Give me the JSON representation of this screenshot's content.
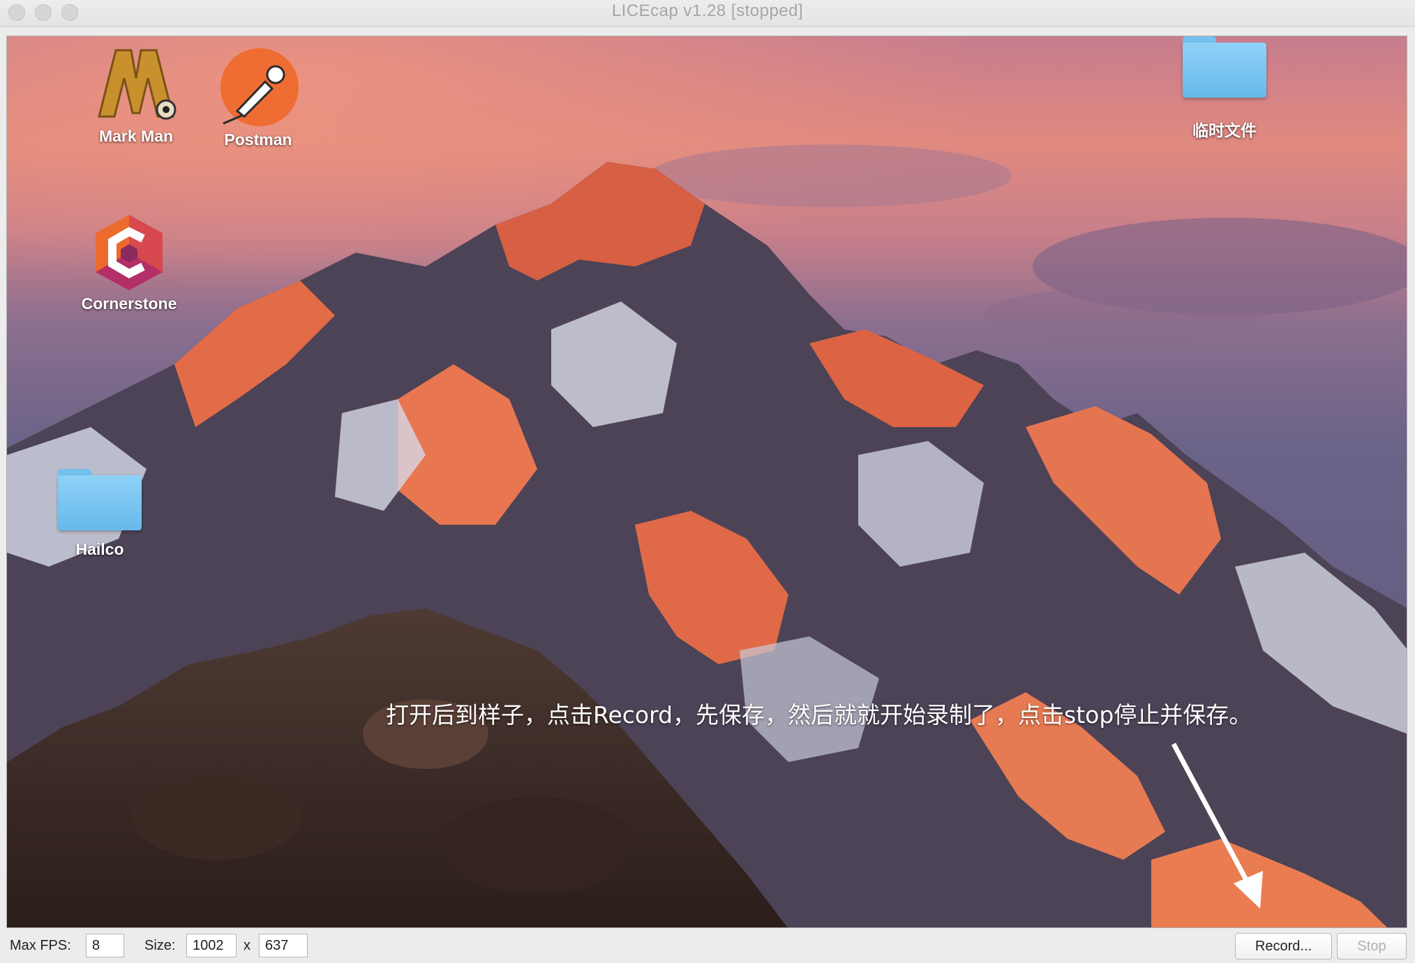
{
  "window": {
    "title": "LICEcap v1.28 [stopped]"
  },
  "desktop": {
    "icons": [
      {
        "label": "Mark Man"
      },
      {
        "label": "Postman"
      },
      {
        "label": "Cornerstone"
      },
      {
        "label": "Hailco"
      },
      {
        "label": "临时文件"
      }
    ],
    "annotation": "打开后到样子，点击Record，先保存，然后就就开始录制了，点击stop停止并保存。"
  },
  "controls": {
    "max_fps_label": "Max FPS:",
    "max_fps_value": "8",
    "size_label": "Size:",
    "width_value": "1002",
    "x_label": "x",
    "height_value": "637",
    "record_label": "Record...",
    "stop_label": "Stop"
  },
  "colors": {
    "sky_top": "#c97a86",
    "sky_glow": "#e08a84",
    "mountain_lit": "#e06a46",
    "mountain_shadow": "#4a3f4c",
    "snow": "#d8d9e6",
    "rocks": "#3a2a26",
    "folder_blue": "#74c0ee"
  }
}
